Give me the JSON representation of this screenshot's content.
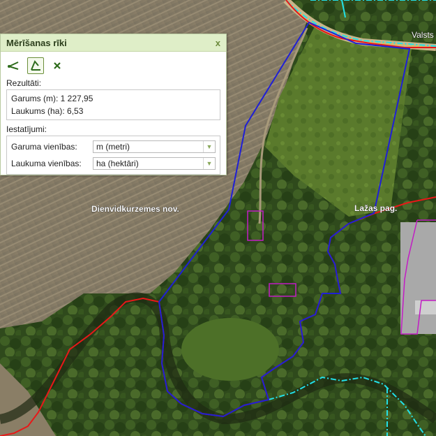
{
  "panel": {
    "title": "Mērīšanas rīki",
    "close_glyph": "x",
    "tools": [
      {
        "icon": "line-measure-icon"
      },
      {
        "icon": "area-measure-icon",
        "active": true
      },
      {
        "icon": "clear-icon"
      }
    ],
    "results_label": "Rezultāti:",
    "length_result": "Garums (m): 1 227,95",
    "area_result": "Laukums (ha): 6,53",
    "settings_label": "Iestatījumi:",
    "length_units_label": "Garuma vienības:",
    "length_units_value": "m (metri)",
    "area_units_label": "Laukuma vienības:",
    "area_units_value": "ha (hektāri)"
  },
  "map": {
    "labels": {
      "municipality": "Dienvidkurzemes nov.",
      "parish": "Lažas pag.",
      "road": "Valsts"
    },
    "colors": {
      "measure_polygon": "#1f1fd6",
      "admin_boundary": "#e81818",
      "water_boundary": "#22e0e8",
      "building_outline": "#c21cc4"
    }
  }
}
